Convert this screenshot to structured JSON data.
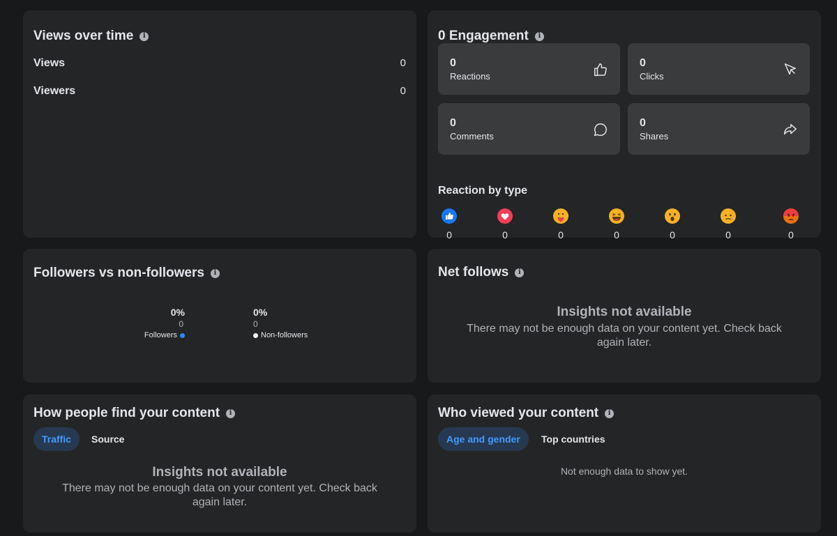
{
  "views_over_time": {
    "title": "Views over time",
    "rows": [
      {
        "label": "Views",
        "value": "0"
      },
      {
        "label": "Viewers",
        "value": "0"
      }
    ]
  },
  "engagement": {
    "title": "0 Engagement",
    "tiles": [
      {
        "value": "0",
        "label": "Reactions",
        "icon": "thumbs-up-icon"
      },
      {
        "value": "0",
        "label": "Clicks",
        "icon": "cursor-icon"
      },
      {
        "value": "0",
        "label": "Comments",
        "icon": "comment-icon"
      },
      {
        "value": "0",
        "label": "Shares",
        "icon": "share-icon"
      }
    ],
    "reaction_title": "Reaction by type",
    "reactions": [
      {
        "icon": "like-reaction-icon",
        "value": "0"
      },
      {
        "icon": "love-reaction-icon",
        "value": "0"
      },
      {
        "icon": "care-reaction-icon",
        "value": "0"
      },
      {
        "icon": "haha-reaction-icon",
        "value": "0"
      },
      {
        "icon": "wow-reaction-icon",
        "value": "0"
      },
      {
        "icon": "sad-reaction-icon",
        "value": "0"
      },
      {
        "icon": "angry-reaction-icon",
        "value": "0"
      }
    ]
  },
  "followers": {
    "title": "Followers vs non-followers",
    "followers": {
      "pct": "0%",
      "count": "0",
      "label": "Followers",
      "color": "#2d88ff"
    },
    "non_followers": {
      "pct": "0%",
      "count": "0",
      "label": "Non-followers",
      "color": "#ffffff"
    }
  },
  "net_follows": {
    "title": "Net follows",
    "empty_title": "Insights not available",
    "empty_text": "There may not be enough data on your content yet. Check back again later."
  },
  "how_find": {
    "title": "How people find your content",
    "tabs": [
      "Traffic",
      "Source"
    ],
    "empty_title": "Insights not available",
    "empty_text": "There may not be enough data on your content yet. Check back again later."
  },
  "who_viewed": {
    "title": "Who viewed your content",
    "tabs": [
      "Age and gender",
      "Top countries"
    ],
    "note": "Not enough data to show yet."
  },
  "colors": {
    "accent": "#2d88ff",
    "active_tab_bg": "#263951",
    "card_bg": "#242526",
    "page_bg": "#18191a"
  }
}
